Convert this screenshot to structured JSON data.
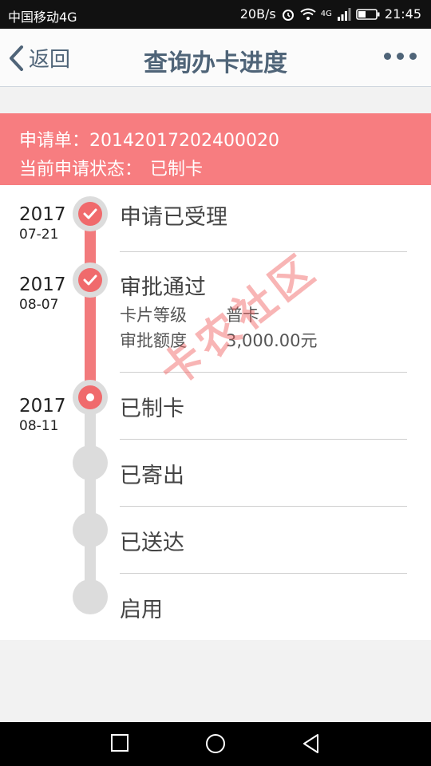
{
  "status_bar": {
    "carrier": "中国移动4G",
    "speed": "20B/s",
    "network": "4G",
    "time": "21:45"
  },
  "nav": {
    "back_label": "返回",
    "title": "查询办卡进度"
  },
  "application": {
    "number_label": "申请单：",
    "number_value": "20142017202400020",
    "status_label": "当前申请状态：",
    "status_value": "已制卡"
  },
  "timeline": [
    {
      "year": "2017",
      "date": "07-21",
      "label": "申请已受理",
      "state": "done"
    },
    {
      "year": "2017",
      "date": "08-07",
      "label": "审批通过",
      "state": "done",
      "details": [
        {
          "key": "卡片等级",
          "value": "普卡"
        },
        {
          "key": "审批额度",
          "value": "3,000.00元"
        }
      ]
    },
    {
      "year": "2017",
      "date": "08-11",
      "label": "已制卡",
      "state": "current"
    },
    {
      "label": "已寄出",
      "state": "pending"
    },
    {
      "label": "已送达",
      "state": "pending"
    },
    {
      "label": "启用",
      "state": "pending"
    }
  ],
  "watermark": "卡农社区",
  "colors": {
    "accent": "#f77d80",
    "timeline_active": "#f27a7c",
    "timeline_inactive": "#dcdcdc",
    "nav_text": "#4f6478"
  }
}
